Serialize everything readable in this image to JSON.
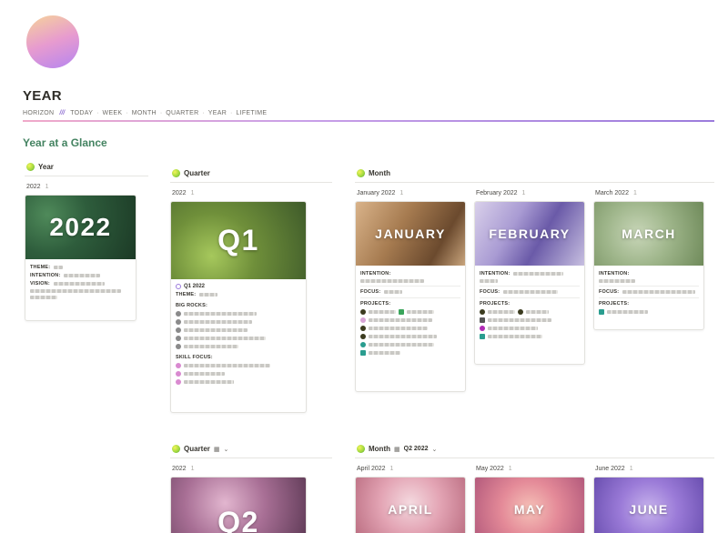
{
  "page": {
    "title": "YEAR",
    "section_title": "Year at a Glance"
  },
  "nav": {
    "items": [
      "HORIZON",
      "TODAY",
      "WEEK",
      "MONTH",
      "QUARTER",
      "YEAR",
      "LIFETIME"
    ],
    "slash": "///",
    "separator": "·"
  },
  "views": {
    "year": {
      "label": "Year",
      "group": "2022",
      "count": "1"
    },
    "quarter": {
      "label": "Quarter",
      "group": "2022",
      "count": "1"
    },
    "month": {
      "label": "Month"
    },
    "quarter2": {
      "label": "Quarter",
      "group": "2022",
      "count": "1"
    },
    "month2": {
      "label": "Month",
      "filter": "Q2 2022"
    }
  },
  "year_card": {
    "cover": "2022",
    "theme_label": "THEME:",
    "intention_label": "INTENTION:",
    "vision_label": "VISION:"
  },
  "q1_card": {
    "cover": "Q1",
    "title": "Q1 2022",
    "theme_label": "THEME:",
    "big_rocks_label": "BIG ROCKS:",
    "skill_focus_label": "SKILL FOCUS:"
  },
  "months": [
    {
      "group": "January 2022",
      "count": "1",
      "cover": "JANUARY",
      "intention_label": "INTENTION:",
      "focus_label": "FOCUS:",
      "projects_label": "PROJECTS:"
    },
    {
      "group": "February 2022",
      "count": "1",
      "cover": "FEBRUARY",
      "intention_label": "INTENTION:",
      "focus_label": "FOCUS:",
      "projects_label": "PROJECTS:"
    },
    {
      "group": "March 2022",
      "count": "1",
      "cover": "MARCH",
      "intention_label": "INTENTION:",
      "focus_label": "FOCUS:",
      "projects_label": "PROJECTS:"
    }
  ],
  "q2_card": {
    "cover": "Q2"
  },
  "months2": [
    {
      "group": "April 2022",
      "count": "1",
      "cover": "APRIL"
    },
    {
      "group": "May 2022",
      "count": "1",
      "cover": "MAY"
    },
    {
      "group": "June 2022",
      "count": "1",
      "cover": "JUNE"
    }
  ],
  "icons": {
    "view": "db-view-icon",
    "gallery": "gallery-icon",
    "chevron": "chevron-down-icon"
  },
  "colors": {
    "section_title": "#448361",
    "nav_line": "#9b7bdc"
  }
}
